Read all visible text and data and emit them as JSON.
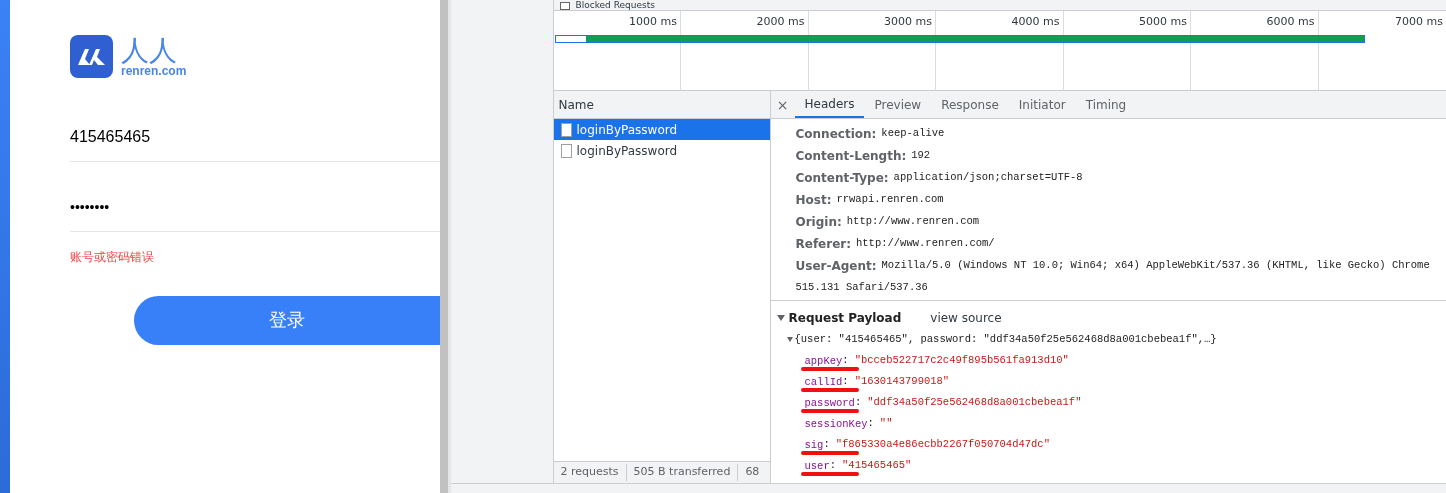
{
  "login": {
    "logo": {
      "title": "人人",
      "subtitle": "renren.com"
    },
    "account": {
      "value": "415465465"
    },
    "password": {
      "value": "••••••••"
    },
    "error": "账号或密码错误",
    "submit": "登录"
  },
  "devtools": {
    "blocked_requests": {
      "label": "Blocked Requests",
      "checked": false
    },
    "timeline": {
      "ticks": [
        "1000 ms",
        "2000 ms",
        "3000 ms",
        "4000 ms",
        "5000 ms",
        "6000 ms",
        "7000 ms"
      ]
    },
    "requests": {
      "column": "Name",
      "rows": [
        {
          "name": "loginByPassword",
          "selected": true
        },
        {
          "name": "loginByPassword",
          "selected": false
        }
      ]
    },
    "detail_tabs": [
      {
        "label": "Headers",
        "selected": true
      },
      {
        "label": "Preview",
        "selected": false
      },
      {
        "label": "Response",
        "selected": false
      },
      {
        "label": "Initiator",
        "selected": false
      },
      {
        "label": "Timing",
        "selected": false
      }
    ],
    "close": "×",
    "headers": [
      {
        "name": "Connection:",
        "value": [
          "keep-alive"
        ]
      },
      {
        "name": "Content-Length:",
        "value": [
          "192"
        ]
      },
      {
        "name": "Content-Type:",
        "value": [
          "application/json;charset=UTF-8"
        ]
      },
      {
        "name": "Host:",
        "value": [
          "rrwapi.renren.com"
        ]
      },
      {
        "name": "Origin:",
        "value": [
          "http://www.renren.com"
        ]
      },
      {
        "name": "Referer:",
        "value": [
          "http://www.renren.com/"
        ]
      },
      {
        "name": "User-Agent:",
        "value": [
          "Mozilla/5.0 (Windows NT 10.0; Win64; x64) AppleWebKit/537.36 (KHTML, like Gecko) Chrome",
          "515.131 Safari/537.36"
        ]
      }
    ],
    "payload": {
      "title": "Request Payload",
      "separator": ":",
      "view_source": "view source",
      "expanded": true,
      "summary": "{user: \"415465465\", password: \"ddf34a50f25e562468d8a001cbebea1f\",…}",
      "fields": [
        {
          "key": "appKey",
          "value": "\"bcceb522717c2c49f895b561fa913d10\"",
          "marked": true
        },
        {
          "key": "callId",
          "value": "\"1630143799018\"",
          "marked": true
        },
        {
          "key": "password",
          "value": "\"ddf34a50f25e562468d8a001cbebea1f\"",
          "marked": true
        },
        {
          "key": "sessionKey",
          "value": "\"\"",
          "marked": false
        },
        {
          "key": "sig",
          "value": "\"f865330a4e86ecbb2267f050704d47dc\"",
          "marked": true
        },
        {
          "key": "user",
          "value": "\"415465465\"",
          "marked": true
        }
      ]
    },
    "status": [
      "2 requests",
      "505 B transferred",
      "68"
    ]
  }
}
